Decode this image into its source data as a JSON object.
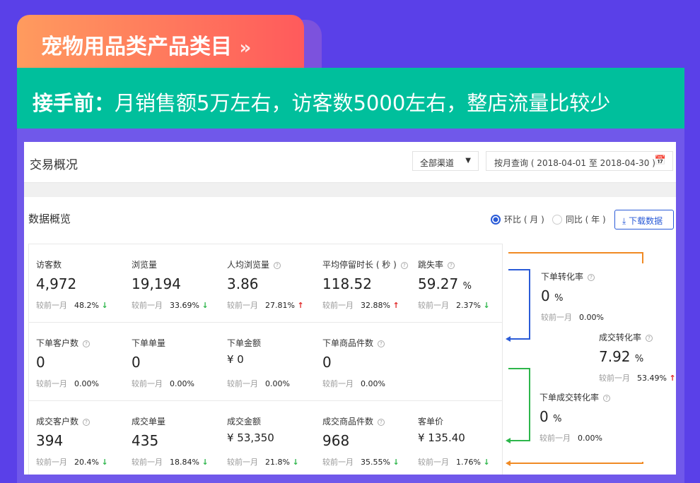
{
  "banner": {
    "category": "宠物用品类产品类目",
    "chevrons": "»",
    "before_label": "接手前：",
    "before_text": "月销售额5万左右，访客数5000左右，整店流量比较少"
  },
  "header": {
    "title": "交易概况",
    "channel": "全部渠道",
    "date_range": "按月查询 ( 2018-04-01 至 2018-04-30 )"
  },
  "overview": {
    "title": "数据概览",
    "radio_mom": "环比 ( 月 )",
    "radio_yoy": "同比 ( 年 )",
    "download": "下载数据",
    "compare_label": "较前一月"
  },
  "rows": [
    [
      {
        "label": "访客数",
        "value": "4,972",
        "pct": "48.2%",
        "trend": "down"
      },
      {
        "label": "浏览量",
        "value": "19,194",
        "pct": "33.69%",
        "trend": "down"
      },
      {
        "label": "人均浏览量",
        "help": true,
        "value": "3.86",
        "pct": "27.81%",
        "trend": "up"
      },
      {
        "label": "平均停留时长 ( 秒 )",
        "help": true,
        "value": "118.52",
        "pct": "32.88%",
        "trend": "up"
      },
      {
        "label": "跳失率",
        "help": true,
        "value": "59.27",
        "unit": "%",
        "pct": "2.37%",
        "trend": "down"
      }
    ],
    [
      {
        "label": "下单客户数",
        "help": true,
        "value": "0",
        "pct": "0.00%"
      },
      {
        "label": "下单单量",
        "value": "0",
        "pct": "0.00%"
      },
      {
        "label": "下单金额",
        "value": "¥ 0",
        "money": true,
        "pct": "0.00%"
      },
      {
        "label": "下单商品件数",
        "help": true,
        "value": "0",
        "pct": "0.00%"
      }
    ],
    [
      {
        "label": "成交客户数",
        "help": true,
        "value": "394",
        "pct": "20.4%",
        "trend": "down"
      },
      {
        "label": "成交单量",
        "value": "435",
        "pct": "18.84%",
        "trend": "down"
      },
      {
        "label": "成交金额",
        "value": "¥ 53,350",
        "money": true,
        "pct": "21.8%",
        "trend": "down"
      },
      {
        "label": "成交商品件数",
        "help": true,
        "value": "968",
        "pct": "35.55%",
        "trend": "down"
      },
      {
        "label": "客单价",
        "value": "¥ 135.40",
        "money": true,
        "pct": "1.76%",
        "trend": "down"
      }
    ]
  ],
  "conversion": [
    {
      "label": "下单转化率",
      "value": "0",
      "unit": "%",
      "pct": "0.00%"
    },
    {
      "label": "成交转化率",
      "value": "7.92",
      "unit": "%",
      "pct": "53.49%",
      "trend": "up"
    },
    {
      "label": "下单成交转化率",
      "value": "0",
      "unit": "%",
      "pct": "0.00%"
    }
  ],
  "colors": {
    "bg": "#5a40e8",
    "teal": "#00bf9c",
    "blue": "#2a5bd7",
    "orange": "#f08a24",
    "green": "#2db64b",
    "red": "#e02a2a"
  }
}
